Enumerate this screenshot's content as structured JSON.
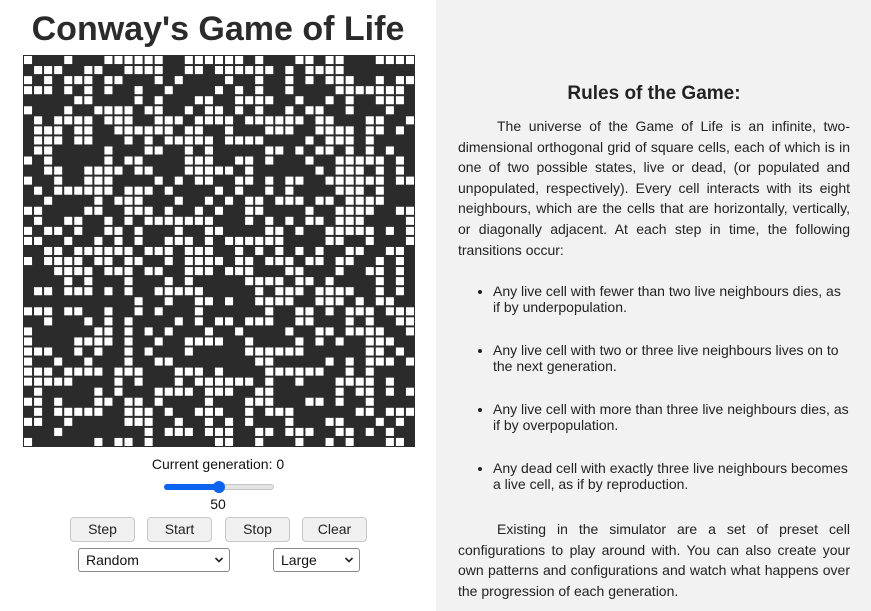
{
  "header": {
    "title": "Conway's Game of Life"
  },
  "board": {
    "cols": 39,
    "rows": 39,
    "alive_color": "#ffffff",
    "dead_color": "#2b2b2b"
  },
  "controls": {
    "generation_label": "Current generation: 0",
    "speed_value": "50",
    "speed_fraction": 0.5,
    "step_label": "Step",
    "start_label": "Start",
    "stop_label": "Stop",
    "clear_label": "Clear",
    "pattern_select": "Random",
    "size_select": "Large"
  },
  "rules": {
    "title": "Rules of the Game:",
    "intro": "The universe of the Game of Life is an infinite, two-dimensional orthogonal grid of square cells, each of which is in one of two possible states, live or dead, (or populated and unpopulated, respectively). Every cell interacts with its eight neighbours, which are the cells that are horizontally, vertically, or diagonally adjacent. At each step in time, the following transitions occur:",
    "items": [
      "Any live cell with fewer than two live neighbours dies, as if by underpopulation.",
      "Any live cell with two or three live neighbours lives on to the next generation.",
      "Any live cell with more than three live neighbours dies, as if by overpopulation.",
      "Any dead cell with exactly three live neighbours becomes a live cell, as if by reproduction."
    ],
    "outro": "Existing in the simulator are a set of preset cell configurations to play around with. You can also create your own patterns and configurations and watch what happens over the progression of each generation."
  },
  "accent_color": "#0a64f0"
}
